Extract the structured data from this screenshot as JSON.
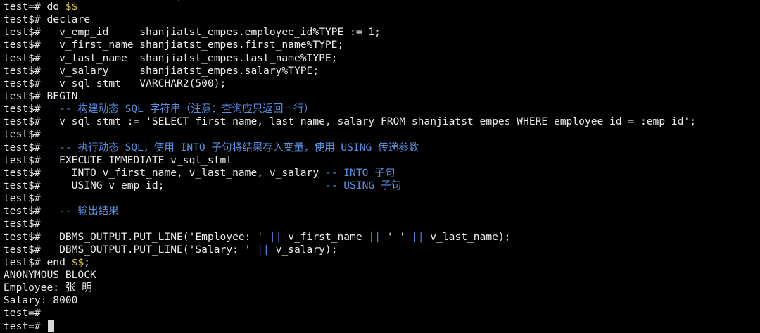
{
  "terminal": {
    "partial_top": "                            )",
    "lines": [
      {
        "prompt": "test=# ",
        "parts": [
          {
            "t": "do ",
            "c": "code"
          },
          {
            "t": "$$",
            "c": "dollar"
          }
        ]
      },
      {
        "prompt": "test$# ",
        "parts": [
          {
            "t": "declare",
            "c": "code"
          }
        ]
      },
      {
        "prompt": "test$# ",
        "parts": [
          {
            "t": "  v_emp_id     shanjiatst_empes.employee_id%TYPE := 1;",
            "c": "code"
          }
        ]
      },
      {
        "prompt": "test$# ",
        "parts": [
          {
            "t": "  v_first_name shanjiatst_empes.first_name%TYPE;",
            "c": "code"
          }
        ]
      },
      {
        "prompt": "test$# ",
        "parts": [
          {
            "t": "  v_last_name  shanjiatst_empes.last_name%TYPE;",
            "c": "code"
          }
        ]
      },
      {
        "prompt": "test$# ",
        "parts": [
          {
            "t": "  v_salary     shanjiatst_empes.salary%TYPE;",
            "c": "code"
          }
        ]
      },
      {
        "prompt": "test$# ",
        "parts": [
          {
            "t": "  v_sql_stmt   VARCHAR2(500);",
            "c": "code"
          }
        ]
      },
      {
        "prompt": "test$# ",
        "parts": [
          {
            "t": "BEGIN",
            "c": "code"
          }
        ]
      },
      {
        "prompt": "test$# ",
        "parts": [
          {
            "t": "  -- 构建动态 SQL 字符串（注意：查询应只返回一行）",
            "c": "comment"
          }
        ]
      },
      {
        "prompt": "test$# ",
        "parts": [
          {
            "t": "  v_sql_stmt := 'SELECT first_name, last_name, salary FROM shanjiatst_empes WHERE employee_id = :emp_id';",
            "c": "code"
          }
        ]
      },
      {
        "prompt": "test$# ",
        "parts": []
      },
      {
        "prompt": "test$# ",
        "parts": [
          {
            "t": "  -- 执行动态 SQL，使用 INTO 子句将结果存入变量，使用 USING 传递参数",
            "c": "comment"
          }
        ]
      },
      {
        "prompt": "test$# ",
        "parts": [
          {
            "t": "  EXECUTE IMMEDIATE v_sql_stmt",
            "c": "code"
          }
        ]
      },
      {
        "prompt": "test$# ",
        "parts": [
          {
            "t": "    INTO v_first_name, v_last_name, v_salary ",
            "c": "code"
          },
          {
            "t": "-- INTO 子句",
            "c": "comment"
          }
        ]
      },
      {
        "prompt": "test$# ",
        "parts": [
          {
            "t": "    USING v_emp_id;                          ",
            "c": "code"
          },
          {
            "t": "-- USING 子句",
            "c": "comment"
          }
        ]
      },
      {
        "prompt": "test$# ",
        "parts": []
      },
      {
        "prompt": "test$# ",
        "parts": [
          {
            "t": "  -- 输出结果",
            "c": "comment"
          }
        ]
      },
      {
        "prompt": "test$# ",
        "parts": []
      },
      {
        "prompt": "test$# ",
        "parts": [
          {
            "t": "  DBMS_OUTPUT.PUT_LINE('Employee: ' ",
            "c": "code"
          },
          {
            "t": "||",
            "c": "op"
          },
          {
            "t": " v_first_name ",
            "c": "code"
          },
          {
            "t": "||",
            "c": "op"
          },
          {
            "t": " ' ' ",
            "c": "code"
          },
          {
            "t": "||",
            "c": "op"
          },
          {
            "t": " v_last_name);",
            "c": "code"
          }
        ]
      },
      {
        "prompt": "test$# ",
        "parts": [
          {
            "t": "  DBMS_OUTPUT.PUT_LINE('Salary: ' ",
            "c": "code"
          },
          {
            "t": "||",
            "c": "op"
          },
          {
            "t": " v_salary);",
            "c": "code"
          }
        ]
      },
      {
        "prompt": "test$# ",
        "parts": [
          {
            "t": "end ",
            "c": "code"
          },
          {
            "t": "$$",
            "c": "dollar"
          },
          {
            "t": ";",
            "c": "code"
          }
        ]
      },
      {
        "prompt": "",
        "parts": [
          {
            "t": "ANONYMOUS BLOCK",
            "c": "out"
          }
        ]
      },
      {
        "prompt": "",
        "parts": [
          {
            "t": "Employee: 张 明",
            "c": "out"
          }
        ]
      },
      {
        "prompt": "",
        "parts": [
          {
            "t": "Salary: 8000",
            "c": "out"
          }
        ]
      },
      {
        "prompt": "test=# ",
        "parts": []
      },
      {
        "prompt": "test=# ",
        "parts": [],
        "cursor": true
      }
    ]
  },
  "colors": {
    "background": "#000000",
    "text": "#e8e8e8",
    "comment": "#5a8fe0",
    "operator": "#4f7fd8",
    "dollar_quote": "#e0c84a",
    "cursor": "#d8d8d8"
  }
}
